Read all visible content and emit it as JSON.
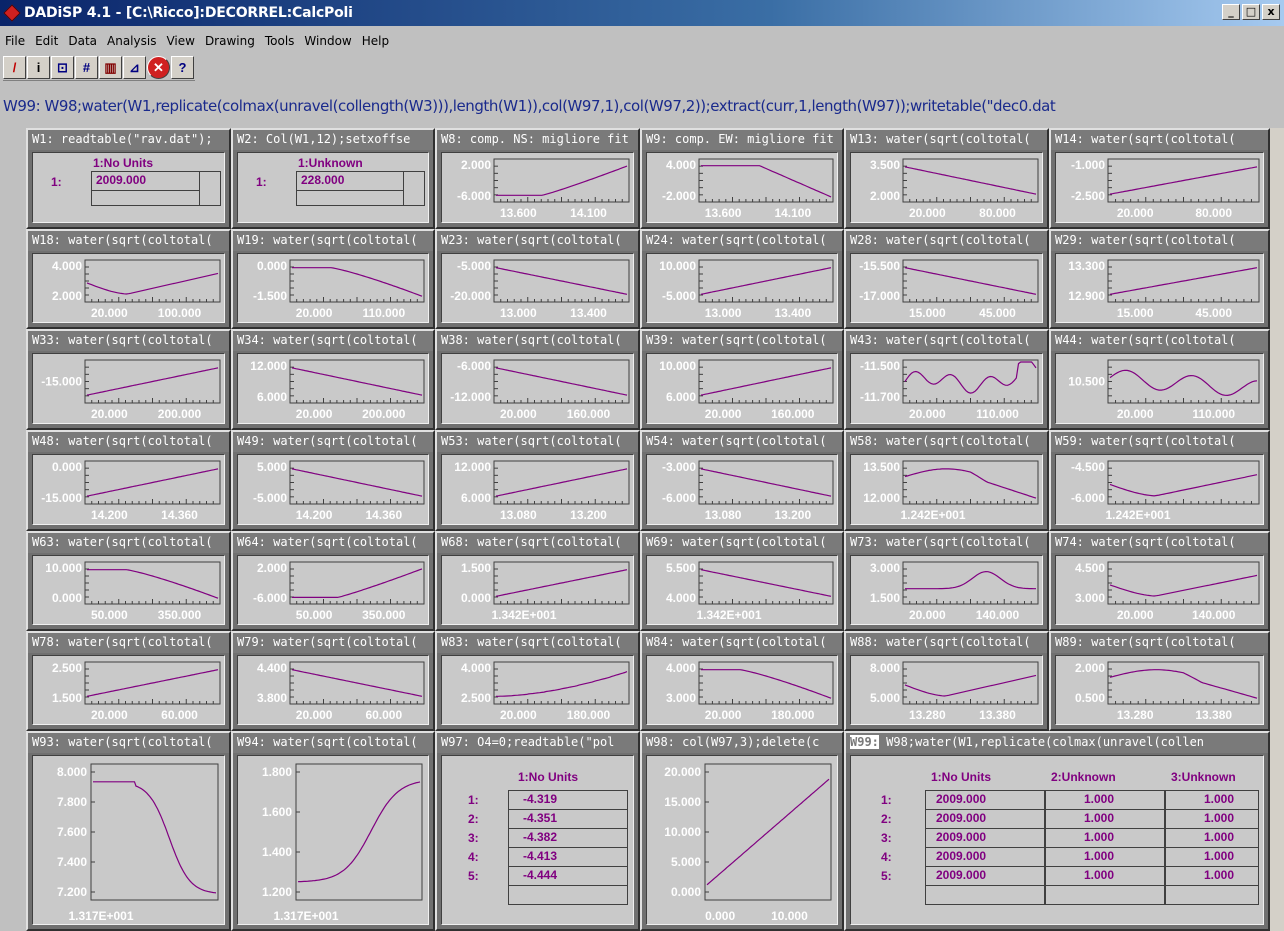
{
  "window": {
    "title": "DADiSP 4.1 - [C:\\Ricco]:DECORREL:CalcPoli",
    "min": "_",
    "max": "□",
    "close": "x"
  },
  "menu": [
    "File",
    "Edit",
    "Data",
    "Analysis",
    "View",
    "Drawing",
    "Tools",
    "Window",
    "Help"
  ],
  "toolbar": [
    {
      "icon": "pencil-icon",
      "glyph": "/",
      "color": "#c00000"
    },
    {
      "icon": "info-icon",
      "glyph": "i",
      "color": "#000"
    },
    {
      "icon": "line-chart-icon",
      "glyph": "⊡",
      "color": "#000080"
    },
    {
      "icon": "grid-icon",
      "glyph": "#",
      "color": "#000080"
    },
    {
      "icon": "bar-chart-icon",
      "glyph": "▥",
      "color": "#800000"
    },
    {
      "icon": "annotate-icon",
      "glyph": "⊿",
      "color": "#000080"
    },
    {
      "icon": "stop-icon",
      "glyph": "✕",
      "color": "#fff",
      "bg": "#d02020"
    },
    {
      "icon": "help-icon",
      "glyph": "?",
      "color": "#000080"
    }
  ],
  "command": "W99: W98;water(W1,replicate(colmax(unravel(collength(W3))),length(W1)),col(W97,1),col(W97,2));extract(curr,1,length(W97));writetable(\"dec0.dat",
  "colors": {
    "plot_line": "#800080",
    "table_text": "#800080",
    "plot_bg": "#c9c9c9"
  },
  "windows": [
    {
      "id": "W1",
      "title": "W1: readtable(\"rav.dat\");",
      "kind": "table",
      "headers": [
        "1:No Units"
      ],
      "rows": [
        [
          "1:",
          "2009.000"
        ]
      ]
    },
    {
      "id": "W2",
      "title": "W2: Col(W1,12);setxoffse",
      "kind": "table",
      "headers": [
        "1:Unknown"
      ],
      "rows": [
        [
          "1:",
          "228.000"
        ]
      ]
    },
    {
      "id": "W8",
      "title": "W8: comp. NS: migliore fit",
      "kind": "plot",
      "y": [
        "2.000",
        "-6.000"
      ],
      "x": [
        "13.600",
        "14.100"
      ],
      "curve": "rise_late"
    },
    {
      "id": "W9",
      "title": "W9: comp. EW: migliore fit",
      "kind": "plot",
      "y": [
        "4.000",
        "-2.000"
      ],
      "x": [
        "13.600",
        "14.100"
      ],
      "curve": "fall_late"
    },
    {
      "id": "W13",
      "title": "W13: water(sqrt(coltotal(",
      "kind": "plot",
      "y": [
        "3.500",
        "2.000"
      ],
      "x": [
        "20.000",
        "80.000"
      ],
      "curve": "fall"
    },
    {
      "id": "W14",
      "title": "W14: water(sqrt(coltotal(",
      "kind": "plot",
      "y": [
        "-1.000",
        "-2.500"
      ],
      "x": [
        "20.000",
        "80.000"
      ],
      "curve": "rise"
    },
    {
      "id": "W18",
      "title": "W18: water(sqrt(coltotal(",
      "kind": "plot",
      "y": [
        "4.000",
        "2.000"
      ],
      "x": [
        "20.000",
        "100.000"
      ],
      "curve": "dip_rise"
    },
    {
      "id": "W19",
      "title": "W19: water(sqrt(coltotal(",
      "kind": "plot",
      "y": [
        "0.000",
        "-1.500"
      ],
      "x": [
        "20.000",
        "110.000"
      ],
      "curve": "flat_fall"
    },
    {
      "id": "W23",
      "title": "W23: water(sqrt(coltotal(",
      "kind": "plot",
      "y": [
        "-5.000",
        "-20.000"
      ],
      "x": [
        "13.000",
        "13.400"
      ],
      "curve": "fall"
    },
    {
      "id": "W24",
      "title": "W24: water(sqrt(coltotal(",
      "kind": "plot",
      "y": [
        "10.000",
        "-5.000"
      ],
      "x": [
        "13.000",
        "13.400"
      ],
      "curve": "rise"
    },
    {
      "id": "W28",
      "title": "W28: water(sqrt(coltotal(",
      "kind": "plot",
      "y": [
        "-15.500",
        "-17.000"
      ],
      "x": [
        "15.000",
        "45.000"
      ],
      "curve": "fall"
    },
    {
      "id": "W29",
      "title": "W29: water(sqrt(coltotal(",
      "kind": "plot",
      "y": [
        "13.300",
        "12.900"
      ],
      "x": [
        "15.000",
        "45.000"
      ],
      "curve": "rise"
    },
    {
      "id": "W33",
      "title": "W33: water(sqrt(coltotal(",
      "kind": "plot",
      "y": [
        "-15.000"
      ],
      "x": [
        "20.000",
        "200.000"
      ],
      "curve": "rise"
    },
    {
      "id": "W34",
      "title": "W34: water(sqrt(coltotal(",
      "kind": "plot",
      "y": [
        "12.000",
        "6.000"
      ],
      "x": [
        "20.000",
        "200.000"
      ],
      "curve": "fall"
    },
    {
      "id": "W38",
      "title": "W38: water(sqrt(coltotal(",
      "kind": "plot",
      "y": [
        "-6.000",
        "-12.000"
      ],
      "x": [
        "20.000",
        "160.000"
      ],
      "curve": "fall"
    },
    {
      "id": "W39",
      "title": "W39: water(sqrt(coltotal(",
      "kind": "plot",
      "y": [
        "10.000",
        "6.000"
      ],
      "x": [
        "20.000",
        "160.000"
      ],
      "curve": "rise"
    },
    {
      "id": "W43",
      "title": "W43: water(sqrt(coltotal(",
      "kind": "plot",
      "y": [
        "-11.500",
        "-11.700"
      ],
      "x": [
        "20.000",
        "110.000"
      ],
      "curve": "wiggle_up"
    },
    {
      "id": "W44",
      "title": "W44: water(sqrt(coltotal(",
      "kind": "plot",
      "y": [
        "10.500"
      ],
      "x": [
        "20.000",
        "110.000"
      ],
      "curve": "wiggle_down"
    },
    {
      "id": "W48",
      "title": "W48: water(sqrt(coltotal(",
      "kind": "plot",
      "y": [
        "0.000",
        "-15.000"
      ],
      "x": [
        "14.200",
        "14.360"
      ],
      "curve": "rise"
    },
    {
      "id": "W49",
      "title": "W49: water(sqrt(coltotal(",
      "kind": "plot",
      "y": [
        "5.000",
        "-5.000"
      ],
      "x": [
        "14.200",
        "14.360"
      ],
      "curve": "fall"
    },
    {
      "id": "W53",
      "title": "W53: water(sqrt(coltotal(",
      "kind": "plot",
      "y": [
        "12.000",
        "6.000"
      ],
      "x": [
        "13.080",
        "13.200"
      ],
      "curve": "rise"
    },
    {
      "id": "W54",
      "title": "W54: water(sqrt(coltotal(",
      "kind": "plot",
      "y": [
        "-3.000",
        "-6.000"
      ],
      "x": [
        "13.080",
        "13.200"
      ],
      "curve": "fall"
    },
    {
      "id": "W58",
      "title": "W58: water(sqrt(coltotal(",
      "kind": "plot",
      "y": [
        "13.500",
        "12.000"
      ],
      "x": [
        "1.242E+001"
      ],
      "curve": "hump_fall"
    },
    {
      "id": "W59",
      "title": "W59: water(sqrt(coltotal(",
      "kind": "plot",
      "y": [
        "-4.500",
        "-6.000"
      ],
      "x": [
        "1.242E+001"
      ],
      "curve": "dip_rise"
    },
    {
      "id": "W63",
      "title": "W63: water(sqrt(coltotal(",
      "kind": "plot",
      "y": [
        "10.000",
        "0.000"
      ],
      "x": [
        "50.000",
        "350.000"
      ],
      "curve": "flat_fall"
    },
    {
      "id": "W64",
      "title": "W64: water(sqrt(coltotal(",
      "kind": "plot",
      "y": [
        "2.000",
        "-6.000"
      ],
      "x": [
        "50.000",
        "350.000"
      ],
      "curve": "rise_late"
    },
    {
      "id": "W68",
      "title": "W68: water(sqrt(coltotal(",
      "kind": "plot",
      "y": [
        "1.500",
        "0.000"
      ],
      "x": [
        "1.342E+001"
      ],
      "curve": "rise"
    },
    {
      "id": "W69",
      "title": "W69: water(sqrt(coltotal(",
      "kind": "plot",
      "y": [
        "5.500",
        "4.000"
      ],
      "x": [
        "1.342E+001"
      ],
      "curve": "fall"
    },
    {
      "id": "W73",
      "title": "W73: water(sqrt(coltotal(",
      "kind": "plot",
      "y": [
        "3.000",
        "1.500"
      ],
      "x": [
        "20.000",
        "140.000"
      ],
      "curve": "bump"
    },
    {
      "id": "W74",
      "title": "W74: water(sqrt(coltotal(",
      "kind": "plot",
      "y": [
        "4.500",
        "3.000"
      ],
      "x": [
        "20.000",
        "140.000"
      ],
      "curve": "dip_rise"
    },
    {
      "id": "W78",
      "title": "W78: water(sqrt(coltotal(",
      "kind": "plot",
      "y": [
        "2.500",
        "1.500"
      ],
      "x": [
        "20.000",
        "60.000"
      ],
      "curve": "rise"
    },
    {
      "id": "W79",
      "title": "W79: water(sqrt(coltotal(",
      "kind": "plot",
      "y": [
        "4.400",
        "3.800"
      ],
      "x": [
        "20.000",
        "60.000"
      ],
      "curve": "fall"
    },
    {
      "id": "W83",
      "title": "W83: water(sqrt(coltotal(",
      "kind": "plot",
      "y": [
        "4.000",
        "2.500"
      ],
      "x": [
        "20.000",
        "180.000"
      ],
      "curve": "steps_up"
    },
    {
      "id": "W84",
      "title": "W84: water(sqrt(coltotal(",
      "kind": "plot",
      "y": [
        "4.000",
        "3.000"
      ],
      "x": [
        "20.000",
        "180.000"
      ],
      "curve": "flat_fall"
    },
    {
      "id": "W88",
      "title": "W88: water(sqrt(coltotal(",
      "kind": "plot",
      "y": [
        "8.000",
        "5.000"
      ],
      "x": [
        "13.280",
        "13.380"
      ],
      "curve": "dip_rise"
    },
    {
      "id": "W89",
      "title": "W89: water(sqrt(coltotal(",
      "kind": "plot",
      "y": [
        "2.000",
        "0.500"
      ],
      "x": [
        "13.280",
        "13.380"
      ],
      "curve": "hump_fall"
    }
  ],
  "big": {
    "W93": {
      "title": "W93: water(sqrt(coltotal(",
      "y": [
        "8.000",
        "7.800",
        "7.600",
        "7.400",
        "7.200"
      ],
      "x": "1.317E+001"
    },
    "W94": {
      "title": "W94: water(sqrt(coltotal(",
      "y": [
        "1.800",
        "1.600",
        "1.400",
        "1.200"
      ],
      "x": "1.317E+001"
    },
    "W97": {
      "title": "W97: O4=0;readtable(\"pol",
      "header": "1:No Units",
      "rows": [
        [
          "1:",
          "-4.319"
        ],
        [
          "2:",
          "-4.351"
        ],
        [
          "3:",
          "-4.382"
        ],
        [
          "4:",
          "-4.413"
        ],
        [
          "5:",
          "-4.444"
        ]
      ]
    },
    "W98": {
      "title": "W98: col(W97,3);delete(c",
      "y": [
        "20.000",
        "15.000",
        "10.000",
        "5.000",
        "0.000"
      ],
      "x": [
        "0.000",
        "10.000"
      ]
    },
    "W99": {
      "label": "W99:",
      "title": " W98;water(W1,replicate(colmax(unravel(collen",
      "headers": [
        "1:No Units",
        "2:Unknown",
        "3:Unknown"
      ],
      "rows": [
        [
          "1:",
          "2009.000",
          "1.000",
          "1.000"
        ],
        [
          "2:",
          "2009.000",
          "1.000",
          "1.000"
        ],
        [
          "3:",
          "2009.000",
          "1.000",
          "1.000"
        ],
        [
          "4:",
          "2009.000",
          "1.000",
          "1.000"
        ],
        [
          "5:",
          "2009.000",
          "1.000",
          "1.000"
        ]
      ]
    }
  }
}
